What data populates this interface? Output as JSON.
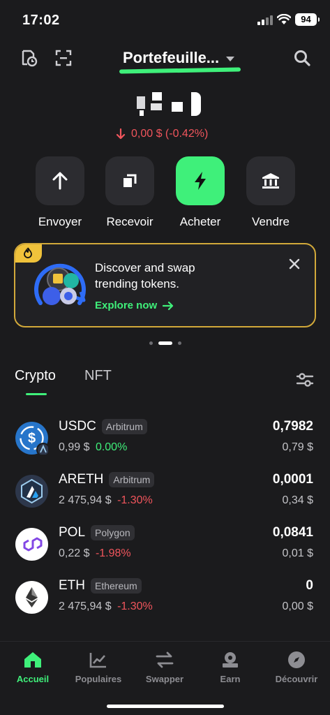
{
  "status_bar": {
    "time": "17:02",
    "battery": "94"
  },
  "header": {
    "wallet_name": "Portefeuille..."
  },
  "balance": {
    "change_text": "0,00 $ (-0.42%)"
  },
  "actions": [
    {
      "label": "Envoyer"
    },
    {
      "label": "Recevoir"
    },
    {
      "label": "Acheter"
    },
    {
      "label": "Vendre"
    }
  ],
  "promo": {
    "text": "Discover and swap trending tokens.",
    "cta": "Explore now"
  },
  "tabs": {
    "crypto": "Crypto",
    "nft": "NFT"
  },
  "tokens": [
    {
      "symbol": "USDC",
      "chain": "Arbitrum",
      "price": "0,99 $",
      "change": "0.00%",
      "amount": "0,7982",
      "value": "0,79 $"
    },
    {
      "symbol": "ARETH",
      "chain": "Arbitrum",
      "price": "2 475,94 $",
      "change": "-1.30%",
      "amount": "0,0001",
      "value": "0,34 $"
    },
    {
      "symbol": "POL",
      "chain": "Polygon",
      "price": "0,22 $",
      "change": "-1.98%",
      "amount": "0,0841",
      "value": "0,01 $"
    },
    {
      "symbol": "ETH",
      "chain": "Ethereum",
      "price": "2 475,94 $",
      "change": "-1.30%",
      "amount": "0",
      "value": "0,00 $"
    }
  ],
  "bottom_nav": [
    {
      "label": "Accueil",
      "icon": "home-icon"
    },
    {
      "label": "Populaires",
      "icon": "chart-icon"
    },
    {
      "label": "Swapper",
      "icon": "swap-icon"
    },
    {
      "label": "Earn",
      "icon": "earn-icon"
    },
    {
      "label": "Découvrir",
      "icon": "compass-icon"
    }
  ],
  "colors": {
    "accent": "#3ff07a",
    "negative": "#f0555c",
    "background": "#1b1b1d",
    "promo_border": "#d2a93a"
  }
}
